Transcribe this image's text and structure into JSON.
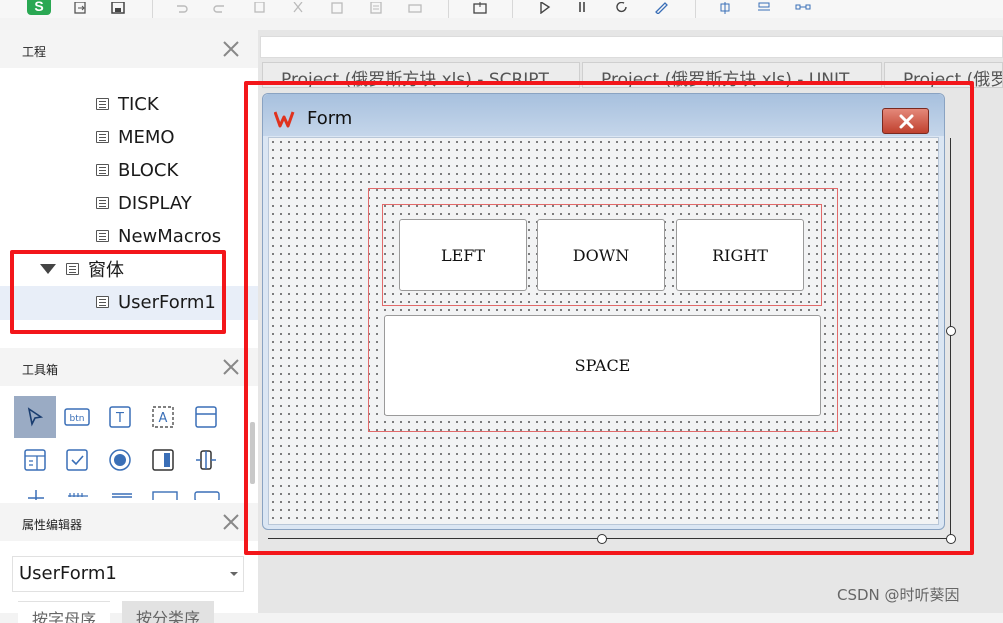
{
  "toolbar": {
    "app_logo": "S",
    "icons": [
      "export-icon",
      "save-icon",
      "undo-icon",
      "redo-icon",
      "copy-icon",
      "cut-icon",
      "paste-icon",
      "paste-special-icon",
      "print-icon",
      "insert-form-icon",
      "run-icon",
      "pause-icon",
      "reset-icon",
      "design-mode-icon",
      "align-icon",
      "distribute-icon",
      "spacing-icon"
    ]
  },
  "project_panel": {
    "title": "工程",
    "items": [
      {
        "label": "TICK"
      },
      {
        "label": "MEMO"
      },
      {
        "label": "BLOCK"
      },
      {
        "label": "DISPLAY"
      },
      {
        "label": "NewMacros"
      }
    ],
    "folder": {
      "label": "窗体"
    },
    "selected_item": {
      "label": "UserForm1"
    }
  },
  "toolbox_panel": {
    "title": "工具箱",
    "tools": [
      {
        "name": "pointer-tool-icon",
        "glyph": ""
      },
      {
        "name": "command-button-tool-icon",
        "glyph": "btn"
      },
      {
        "name": "label-tool-icon",
        "glyph": "T"
      },
      {
        "name": "textbox-tool-icon",
        "glyph": "A"
      },
      {
        "name": "frame-tool-icon",
        "glyph": ""
      },
      {
        "name": "combobox-tool-icon",
        "glyph": ""
      },
      {
        "name": "checkbox-tool-icon",
        "glyph": ""
      },
      {
        "name": "option-button-tool-icon",
        "glyph": ""
      },
      {
        "name": "toggle-button-tool-icon",
        "glyph": ""
      },
      {
        "name": "spin-button-tool-icon",
        "glyph": ""
      }
    ]
  },
  "property_panel": {
    "title": "属性编辑器",
    "selected_object": "UserForm1",
    "tabs": [
      "按字母序",
      "按分类序"
    ]
  },
  "editor_tabs": [
    {
      "label": "Project (俄罗斯方块.xls) - SCRIPT"
    },
    {
      "label": "Project (俄罗斯方块.xls) - UNIT"
    },
    {
      "label": "Project (俄罗"
    }
  ],
  "form": {
    "title": "Form",
    "buttons": {
      "left": "LEFT",
      "down": "DOWN",
      "right": "RIGHT",
      "space": "SPACE"
    }
  },
  "watermark": "CSDN @时听葵因",
  "colors": {
    "highlight_red": "#f3161a",
    "frame_red": "#e26a6a",
    "form_title_blue": "#a7c0de",
    "close_red": "#c0412e"
  }
}
